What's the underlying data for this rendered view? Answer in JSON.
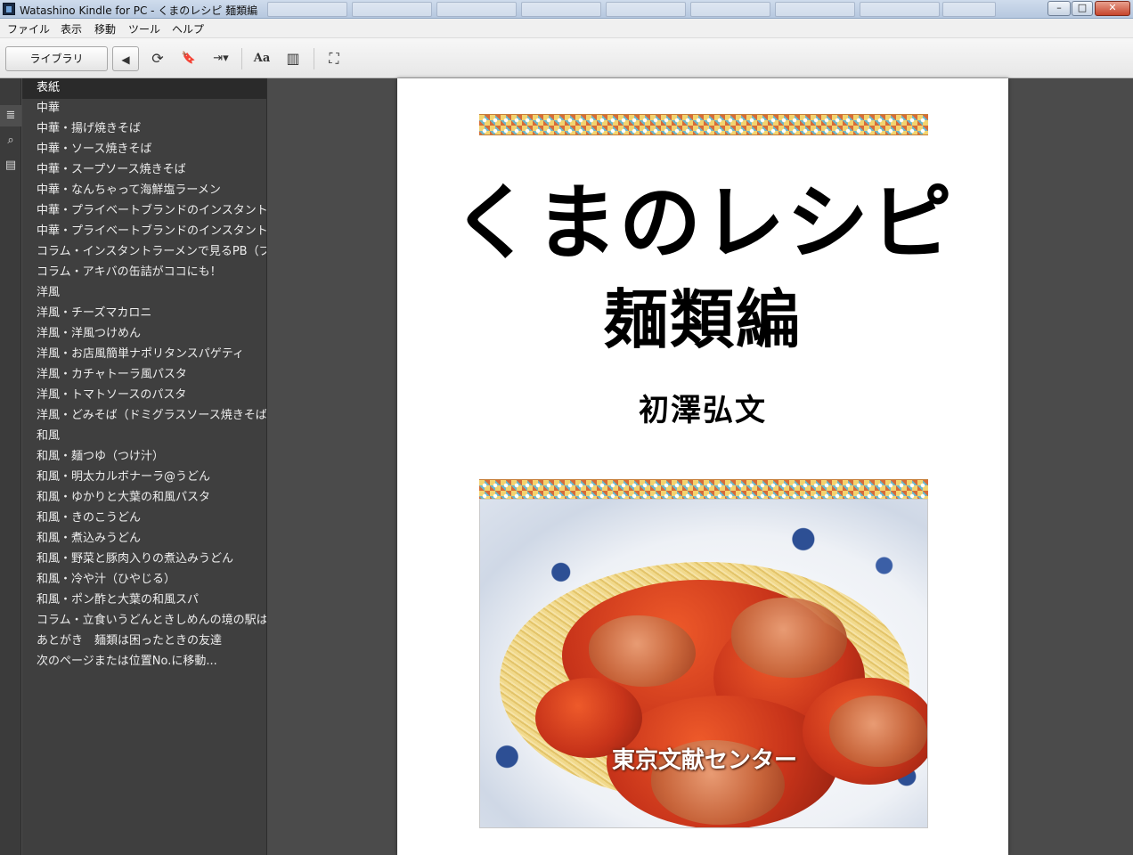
{
  "window": {
    "title": "Watashino Kindle for PC - くまのレシピ 麺類編",
    "buttons": {
      "minimize": "–",
      "maximize": "□",
      "close": "✕"
    }
  },
  "menu": {
    "items": [
      "ファイル",
      "表示",
      "移動",
      "ツール",
      "ヘルプ"
    ]
  },
  "toolbar": {
    "library_label": "ライブラリ",
    "icons": {
      "back": "◀",
      "sync": "⟳",
      "bookmark": "🔖",
      "goto": "⇥▾",
      "font": "Aa",
      "view": "▥",
      "fullscreen": "⛶"
    }
  },
  "sidebar_icons": {
    "toc": "≣",
    "search": "⌕",
    "notes": "▤"
  },
  "toc": {
    "items": [
      "表紙",
      "中華",
      "中華・揚げ焼きそば",
      "中華・ソース焼きそば",
      "中華・スープソース焼きそば",
      "中華・なんちゃって海鮮塩ラーメン",
      "中華・プライベートブランドのインスタントラーメン",
      "中華・プライベートブランドのインスタントラーメン",
      "コラム・インスタントラーメンで見るPB（プライベートブランド）",
      "コラム・アキバの缶詰がココにも！",
      "洋風",
      "洋風・チーズマカロニ",
      "洋風・洋風つけめん",
      "洋風・お店風簡単ナポリタンスパゲティ",
      "洋風・カチャトーラ風パスタ",
      "洋風・トマトソースのパスタ",
      "洋風・どみそば（ドミグラスソース焼きそば）",
      "和風",
      "和風・麺つゆ（つけ汁）",
      "和風・明太カルボナーラ@うどん",
      "和風・ゆかりと大葉の和風パスタ",
      "和風・きのこうどん",
      "和風・煮込みうどん",
      "和風・野菜と豚肉入りの煮込みうどん",
      "和風・冷や汁（ひやじる）",
      "和風・ポン酢と大葉の和風スパ",
      "コラム・立食いうどんときしめんの境の駅は",
      "あとがき　麺類は困ったときの友達",
      "次のページまたは位置No.に移動..."
    ],
    "selected_index": 0
  },
  "page": {
    "title": "くまのレシピ",
    "subtitle": "麺類編",
    "author": "初澤弘文",
    "photo_label": "東京文献センター"
  }
}
